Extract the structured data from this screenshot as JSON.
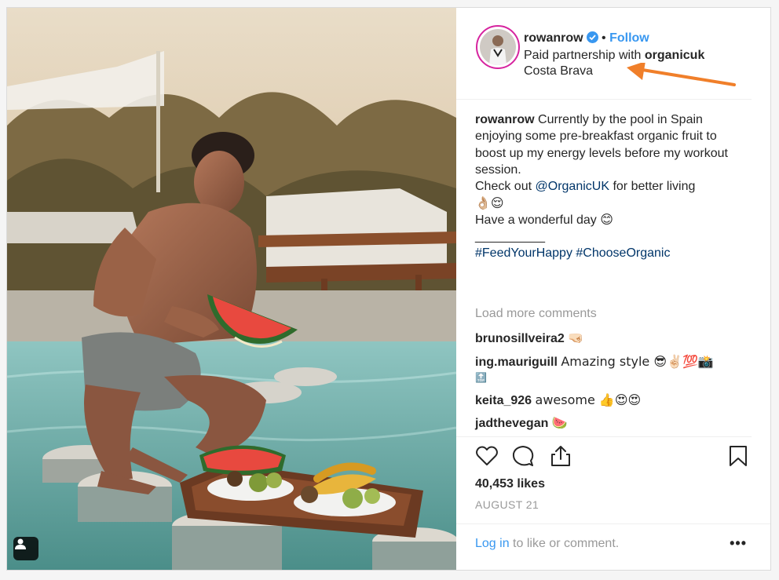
{
  "post": {
    "username": "rowanrow",
    "follow_label": "Follow",
    "dot": "•",
    "partnership_prefix": "Paid partnership with",
    "partner": "organicuk",
    "location": "Costa Brava"
  },
  "caption": {
    "handle": "rowanrow",
    "line1": "Currently by the pool in Spain enjoying some pre-breakfast organic fruit to boost up my energy levels before my workout session.",
    "check_out": "Check out",
    "mention": "@OrganicUK",
    "check_out_tail": "for better living",
    "emoji_line": "👌🏼😌",
    "wish": "Have a wonderful day 😊",
    "separator": "__________",
    "hashtags": "#FeedYourHappy #ChooseOrganic"
  },
  "load_more": "Load more comments",
  "comments": [
    {
      "user": "brunosillveira2",
      "text": "🤜🏻"
    },
    {
      "user": "ing.mauriguill",
      "text": "Amazing style 😎✌🏻💯📸",
      "extra": "🔝"
    },
    {
      "user": "keita_926",
      "text": "awesome 👍😍😍"
    },
    {
      "user": "jadthevegan",
      "text": "🍉"
    }
  ],
  "likes": "40,453 likes",
  "date": "AUGUST 21",
  "login": {
    "link": "Log in",
    "rest": "to like or comment."
  },
  "more_label": "•••",
  "icons": {
    "like": "heart-icon",
    "comment": "comment-icon",
    "share": "share-icon",
    "save": "bookmark-icon",
    "verified": "verified-badge-icon",
    "tag": "user-tag-icon"
  },
  "colors": {
    "link_blue": "#3897f0",
    "dark_link": "#003569",
    "muted": "#999999",
    "arrow": "#f07f2a"
  }
}
